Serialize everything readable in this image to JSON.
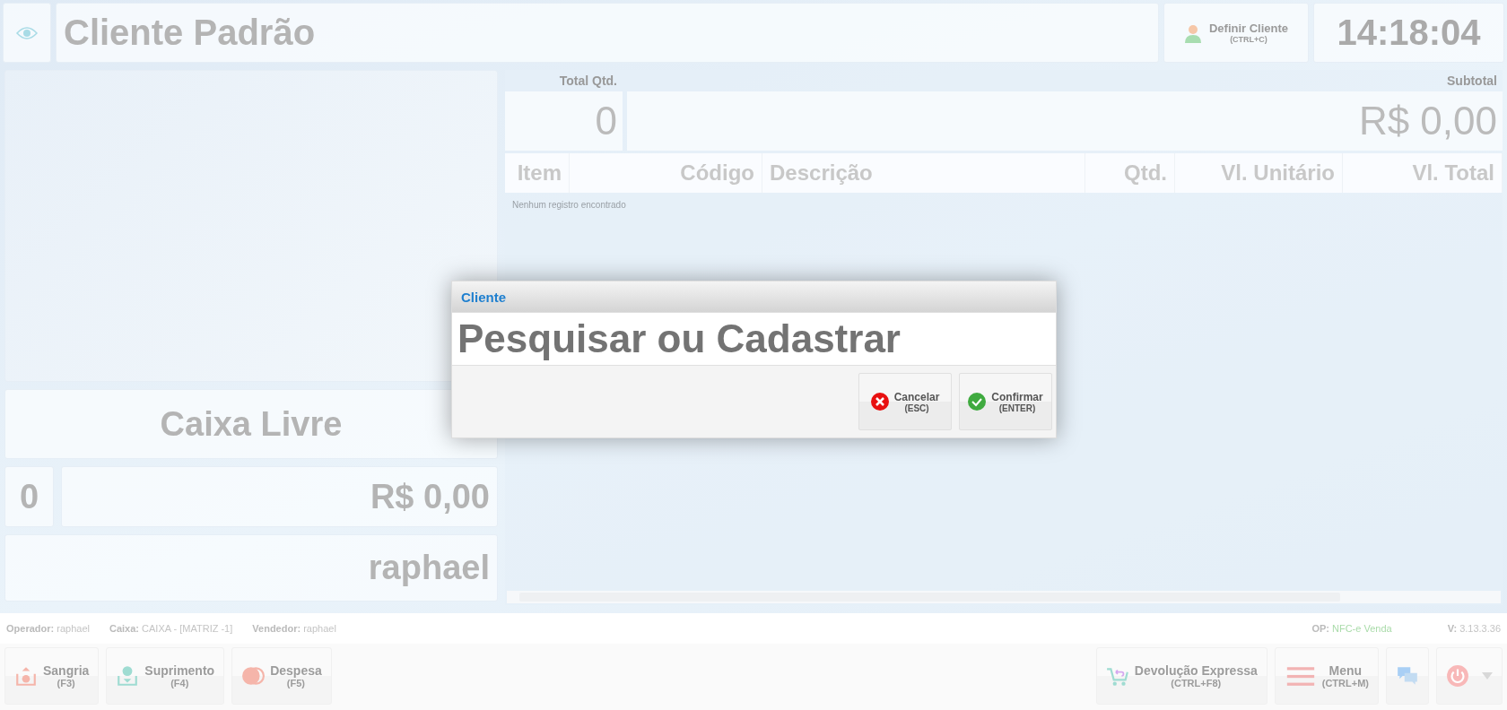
{
  "header": {
    "customer": "Cliente Padrão",
    "define_customer": {
      "label": "Definir Cliente",
      "shortcut": "(CTRL+C)"
    },
    "clock": "14:18:04"
  },
  "left": {
    "status": "Caixa Livre",
    "count": "0",
    "total": "R$ 0,00",
    "operator": "raphael"
  },
  "totals": {
    "qty_label": "Total Qtd.",
    "qty": "0",
    "subtotal_label": "Subtotal",
    "subtotal": "R$ 0,00"
  },
  "table": {
    "columns": [
      "Item",
      "Código",
      "Descrição",
      "Qtd.",
      "Vl. Unitário",
      "Vl. Total"
    ],
    "empty": "Nenhum registro encontrado"
  },
  "status_bar": {
    "left": [
      {
        "label": "Operador:",
        "value": "raphael"
      },
      {
        "label": "Caixa:",
        "value": "CAIXA - [MATRIZ -1]"
      },
      {
        "label": "Vendedor:",
        "value": "raphael"
      }
    ],
    "op": {
      "label": "OP:",
      "value": "NFC-e Venda"
    },
    "version": {
      "label": "V:",
      "value": "3.13.3.36"
    }
  },
  "toolbar_left": [
    {
      "kind": "sangria",
      "label": "Sangria",
      "shortcut": "(F3)"
    },
    {
      "kind": "suprimento",
      "label": "Suprimento",
      "shortcut": "(F4)"
    },
    {
      "kind": "despesa",
      "label": "Despesa",
      "shortcut": "(F5)"
    }
  ],
  "toolbar_right": [
    {
      "kind": "devolucao",
      "label": "Devolução Expressa",
      "shortcut": "(CTRL+F8)"
    },
    {
      "kind": "menu",
      "label": "Menu",
      "shortcut": "(CTRL+M)"
    },
    {
      "kind": "chat"
    },
    {
      "kind": "power"
    }
  ],
  "dialog": {
    "title": "Cliente",
    "placeholder": "Pesquisar ou Cadastrar",
    "buttons": [
      {
        "kind": "cancel",
        "label": "Cancelar",
        "shortcut": "(ESC)"
      },
      {
        "kind": "confirm",
        "label": "Confirmar",
        "shortcut": "(ENTER)"
      }
    ]
  }
}
